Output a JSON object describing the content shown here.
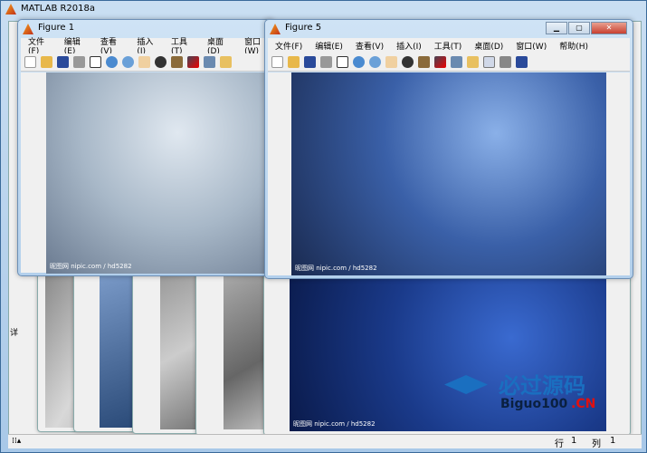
{
  "app": {
    "title": "MATLAB R2018a"
  },
  "figure1": {
    "title": "Figure 1"
  },
  "figure5": {
    "title": "Figure 5"
  },
  "menu": [
    "文件(F)",
    "编辑(E)",
    "查看(V)",
    "插入(I)",
    "工具(T)",
    "桌面(D)",
    "窗口(W)",
    "帮助(H)"
  ],
  "toolbar_icons": [
    "new-file-icon",
    "open-folder-icon",
    "save-icon",
    "print-icon",
    "pointer-icon",
    "zoom-in-icon",
    "zoom-out-icon",
    "pan-icon",
    "rotate-icon",
    "data-cursor-icon",
    "brush-icon",
    "link-icon",
    "colorbar-icon",
    "legend-icon",
    "hide-icon",
    "show-icon"
  ],
  "image_watermark": "昵图网 nipic.com / hd5282",
  "side_label": "详",
  "status": {
    "row_label": "行",
    "row": "1",
    "col_label": "列",
    "col": "1"
  },
  "site_watermark": {
    "cn": "必过源码",
    "domain": "Biguo100",
    "tld": ".CN"
  },
  "colors": {
    "accent": "#1a6fc0",
    "red": "#e01010"
  }
}
